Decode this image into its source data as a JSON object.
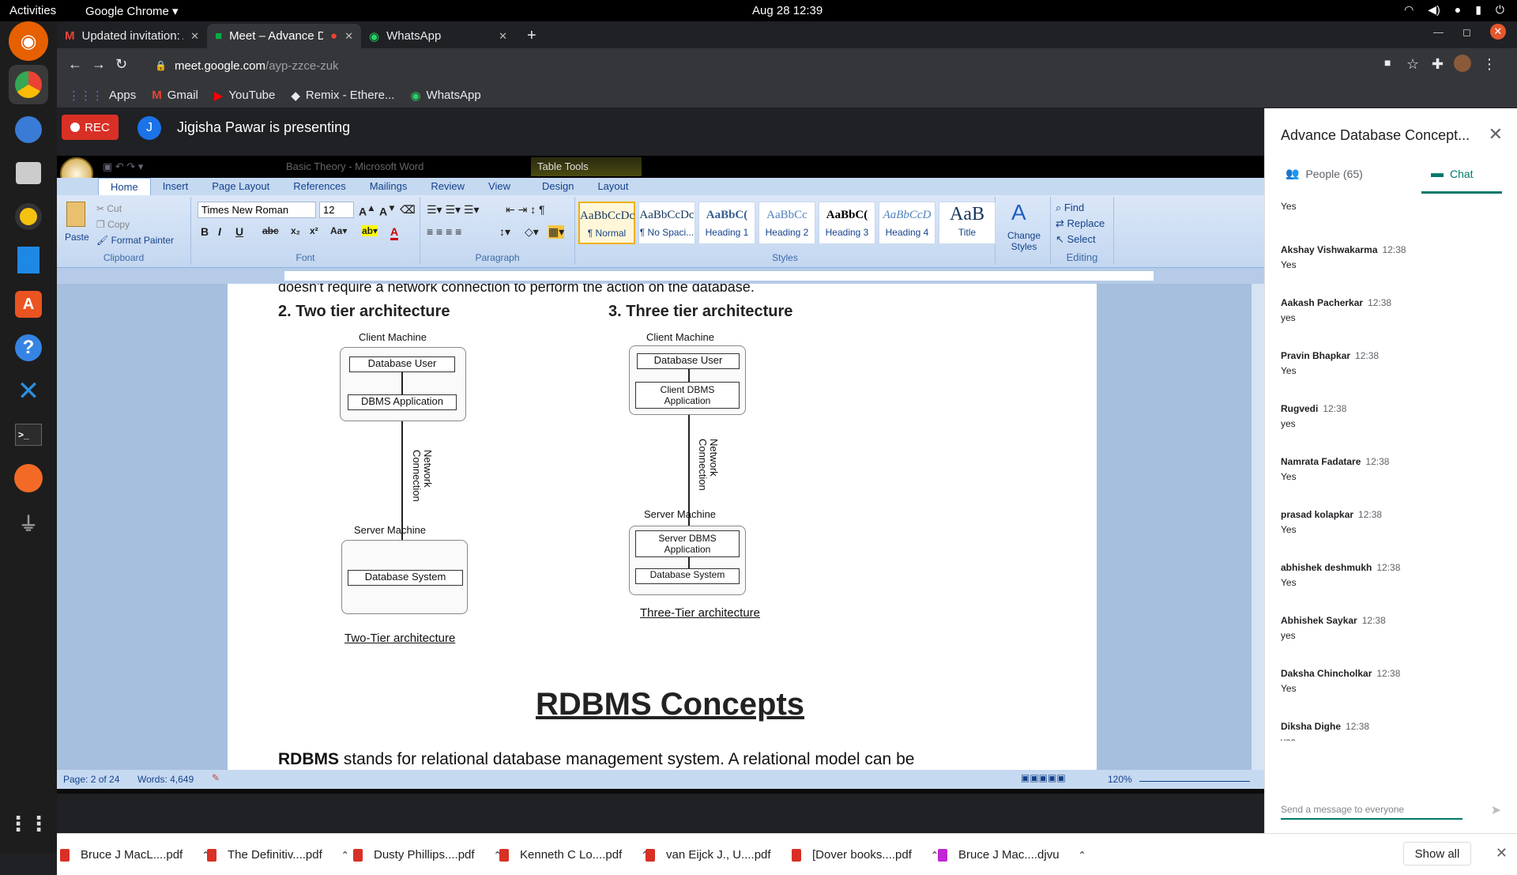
{
  "topbar": {
    "activities": "Activities",
    "app": "Google Chrome ▾",
    "clock": "Aug 28  12:39",
    "icons": [
      "wifi-icon",
      "volume-icon",
      "mic-icon",
      "battery-icon",
      "power-icon"
    ]
  },
  "tabs": [
    {
      "title": "Updated invitation: Advar",
      "icon": "gmail-icon"
    },
    {
      "title": "Meet – Advance Datab",
      "icon": "meet-icon"
    },
    {
      "title": "WhatsApp",
      "icon": "whatsapp-icon"
    }
  ],
  "omnibox": {
    "host": "meet.google.com",
    "path": "/ayp-zzce-zuk"
  },
  "bookmarks": [
    "Apps",
    "Gmail",
    "YouTube",
    "Remix - Ethere...",
    "WhatsApp"
  ],
  "meet": {
    "rec": "REC",
    "presenter_initial": "J",
    "presenting": "Jigisha Pawar is presenting"
  },
  "word": {
    "title": "Basic Theory - Microsoft Word",
    "table_tools": "Table Tools",
    "tabs": [
      "Home",
      "Insert",
      "Page Layout",
      "References",
      "Mailings",
      "Review",
      "View",
      "Design",
      "Layout"
    ],
    "clipboard": {
      "paste": "Paste",
      "cut": "Cut",
      "copy": "Copy",
      "format_painter": "Format Painter",
      "group": "Clipboard"
    },
    "font": {
      "name": "Times New Roman",
      "size": "12",
      "group": "Font"
    },
    "paragraph_group": "Paragraph",
    "styles": [
      {
        "sample": "AaBbCcDc",
        "name": "¶ Normal"
      },
      {
        "sample": "AaBbCcDc",
        "name": "¶ No Spaci..."
      },
      {
        "sample": "AaBbC(",
        "name": "Heading 1"
      },
      {
        "sample": "AaBbCc",
        "name": "Heading 2"
      },
      {
        "sample": "AaBbC(",
        "name": "Heading 3"
      },
      {
        "sample": "AaBbCcD",
        "name": "Heading 4"
      },
      {
        "sample": "AaB",
        "name": "Title"
      }
    ],
    "change_styles": "Change Styles",
    "styles_group": "Styles",
    "editing": {
      "find": "Find",
      "replace": "Replace",
      "select": "Select",
      "group": "Editing"
    },
    "status": {
      "page": "Page: 2 of 24",
      "words": "Words: 4,649",
      "zoom": "120%"
    }
  },
  "document": {
    "top_line": "doesn't require a network connection to perform the action on the database.",
    "two_tier_heading": "2. Two tier architecture",
    "three_tier_heading": "3. Three tier architecture",
    "two_tier": {
      "client_machine": "Client Machine",
      "db_user": "Database User",
      "dbms_app": "DBMS Application",
      "network": "Network Connection",
      "server_machine": "Server Machine",
      "db_system": "Database System",
      "caption": "Two-Tier architecture"
    },
    "three_tier": {
      "client_machine": "Client Machine",
      "db_user": "Database User",
      "client_dbms": "Client DBMS Application",
      "network": "Network Connection",
      "server_machine": "Server Machine",
      "server_dbms": "Server DBMS Application",
      "db_system": "Database System",
      "caption": "Three-Tier architecture"
    },
    "rdbms_heading": "RDBMS Concepts",
    "rdbms_bold": "RDBMS",
    "rdbms_text": " stands for relational database management system. A relational model can be"
  },
  "panel": {
    "title": "Advance Database Concept...",
    "people_tab": "People (65)",
    "chat_tab": "Chat",
    "first_text": "Yes",
    "messages": [
      {
        "sender": "Akshay Vishwakarma",
        "time": "12:38",
        "text": "Yes"
      },
      {
        "sender": "Aakash Pacherkar",
        "time": "12:38",
        "text": "yes"
      },
      {
        "sender": "Pravin Bhapkar",
        "time": "12:38",
        "text": "Yes"
      },
      {
        "sender": "Rugvedi",
        "time": "12:38",
        "text": "yes"
      },
      {
        "sender": "Namrata Fadatare",
        "time": "12:38",
        "text": "Yes"
      },
      {
        "sender": "prasad kolapkar",
        "time": "12:38",
        "text": "Yes"
      },
      {
        "sender": "abhishek deshmukh",
        "time": "12:38",
        "text": "Yes"
      },
      {
        "sender": "Abhishek Saykar",
        "time": "12:38",
        "text": "yes"
      },
      {
        "sender": "Daksha Chincholkar",
        "time": "12:38",
        "text": "Yes"
      },
      {
        "sender": "Diksha Dighe",
        "time": "12:38",
        "text": "yes"
      }
    ],
    "input_placeholder": "Send a message to everyone"
  },
  "downloads": {
    "items": [
      "Bruce J MacL....pdf",
      "The Definitiv....pdf",
      "Dusty Phillips....pdf",
      "Kenneth C Lo....pdf",
      "van Eijck J., U....pdf",
      "[Dover books....pdf",
      "Bruce J Mac....djvu"
    ],
    "show_all": "Show all"
  },
  "colors": {
    "rec": "#d93025",
    "chat_accent": "#00796b",
    "presenter": "#1a73e8"
  }
}
